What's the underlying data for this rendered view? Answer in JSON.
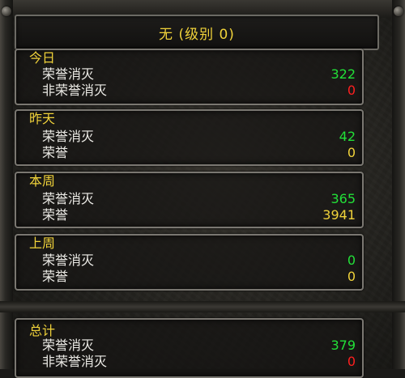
{
  "header": {
    "title": "无 (级别 0)"
  },
  "sections": [
    {
      "title": "今日",
      "rows": [
        {
          "label": "荣誉消灭",
          "value": "322",
          "color": "green"
        },
        {
          "label": "非荣誉消灭",
          "value": "0",
          "color": "red"
        }
      ]
    },
    {
      "title": "昨天",
      "rows": [
        {
          "label": "荣誉消灭",
          "value": "42",
          "color": "green"
        },
        {
          "label": "荣誉",
          "value": "0",
          "color": "yellow"
        }
      ]
    },
    {
      "title": "本周",
      "rows": [
        {
          "label": "荣誉消灭",
          "value": "365",
          "color": "green"
        },
        {
          "label": "荣誉",
          "value": "3941",
          "color": "yellow"
        }
      ]
    },
    {
      "title": "上周",
      "rows": [
        {
          "label": "荣誉消灭",
          "value": "0",
          "color": "green"
        },
        {
          "label": "荣誉",
          "value": "0",
          "color": "yellow"
        }
      ]
    },
    {
      "title": "总计",
      "rows": [
        {
          "label": "荣誉消灭",
          "value": "379",
          "color": "green"
        },
        {
          "label": "非荣誉消灭",
          "value": "0",
          "color": "red"
        }
      ]
    }
  ],
  "colors": {
    "gold": "#f0d23a",
    "green": "#22e038",
    "red": "#ff1f1f",
    "white": "#ecebe6"
  }
}
